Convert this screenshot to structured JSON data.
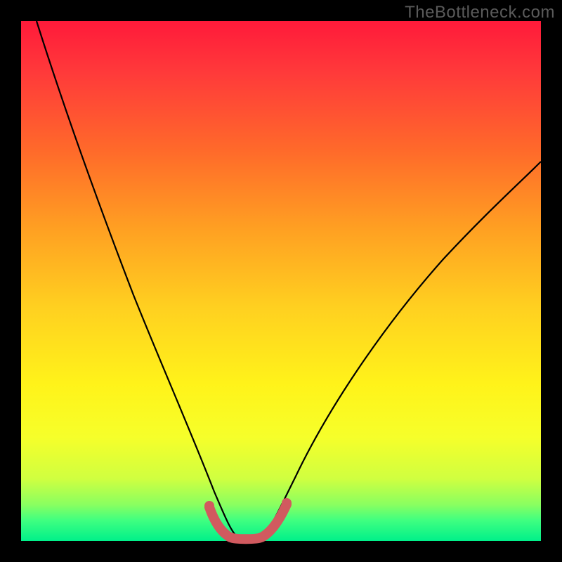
{
  "watermark": "TheBottleneck.com",
  "chart_data": {
    "type": "line",
    "title": "",
    "xlabel": "",
    "ylabel": "",
    "xlim": [
      0,
      100
    ],
    "ylim": [
      0,
      100
    ],
    "series": [
      {
        "name": "bottleneck-curve",
        "x": [
          3,
          6,
          10,
          14,
          18,
          22,
          26,
          30,
          33,
          36,
          38,
          40,
          42,
          44,
          47,
          49,
          54,
          60,
          66,
          72,
          78,
          85,
          92,
          100
        ],
        "y": [
          100,
          88,
          75,
          63,
          52,
          42,
          33,
          24,
          17,
          11,
          7,
          3,
          1,
          1,
          3,
          7,
          15,
          24,
          32,
          40,
          47,
          53,
          58,
          62
        ]
      },
      {
        "name": "minimum-band",
        "x": [
          36,
          38,
          40,
          42,
          44,
          46,
          48
        ],
        "y": [
          6,
          3,
          1,
          1,
          1,
          3,
          6
        ]
      }
    ],
    "gradient_stops": [
      {
        "pos": 0,
        "color": "#ff1a3a"
      },
      {
        "pos": 25,
        "color": "#ff6a2a"
      },
      {
        "pos": 55,
        "color": "#ffd020"
      },
      {
        "pos": 80,
        "color": "#f6ff2a"
      },
      {
        "pos": 100,
        "color": "#00f08a"
      }
    ]
  }
}
